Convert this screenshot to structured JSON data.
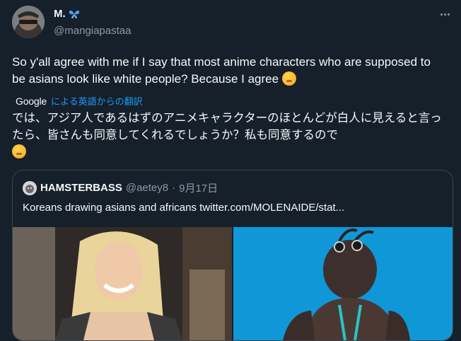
{
  "author": {
    "display_name": "M.",
    "handle": "@mangiapastaa"
  },
  "tweet": {
    "text": "So y'all agree with me if I say that most anime characters who are supposed to be asians look like white people? Because I agree",
    "emoji": "woozy-face"
  },
  "translation": {
    "provider": "Google",
    "link_label": "による英語からの翻訳",
    "text": "では、アジア人であるはずのアニメキャラクターのほとんどが白人に見えると言ったら、皆さんも同意してくれるでしょうか？私も同意するので"
  },
  "quoted": {
    "display_name": "HAMSTERBASS",
    "handle": "@aetey8",
    "separator": "·",
    "date": "9月17日",
    "text": "Koreans drawing asians and africans  twitter.com/MOLENAIDE/stat..."
  },
  "colors": {
    "background": "#15202b",
    "text": "#f7f9f9",
    "muted": "#8b98a5",
    "link": "#1d9bf0",
    "border": "#38444d"
  }
}
